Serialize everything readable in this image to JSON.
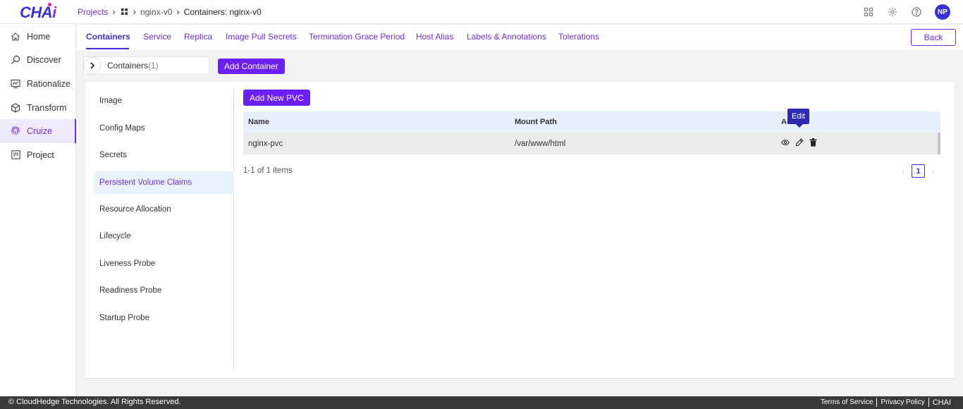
{
  "app": {
    "logo_text": "CHA",
    "logo_accent": "i"
  },
  "breadcrumb": {
    "projects": "Projects",
    "workspace": "nginx-v0",
    "current": "Containers: nginx-v0"
  },
  "user": {
    "initials": "NP"
  },
  "sidebar": {
    "items": [
      {
        "label": "Home",
        "icon": "home-icon"
      },
      {
        "label": "Discover",
        "icon": "discover-icon"
      },
      {
        "label": "Rationalize",
        "icon": "rationalize-icon"
      },
      {
        "label": "Transform",
        "icon": "cube-icon"
      },
      {
        "label": "Cruize",
        "icon": "fingerprint-icon"
      },
      {
        "label": "Project",
        "icon": "board-icon"
      }
    ]
  },
  "tabs": {
    "items": [
      "Containers",
      "Service",
      "Replica",
      "Image Pull Secrets",
      "Termination Grace Period",
      "Host Alias",
      "Labels & Annotations",
      "Tolerations"
    ],
    "back": "Back"
  },
  "containers": {
    "label": "Containers",
    "count": "(1)",
    "add_button": "Add Container"
  },
  "leftmenu": {
    "items": [
      "Image",
      "Config Maps",
      "Secrets",
      "Persistent Volume Claims",
      "Resource Allocation",
      "Lifecycle",
      "Liveness Probe",
      "Readiness Probe",
      "Startup Probe"
    ]
  },
  "pvc": {
    "add_button": "Add New PVC",
    "columns": {
      "name": "Name",
      "mount_path": "Mount Path",
      "actions": "Ac"
    },
    "rows": [
      {
        "name": "nginx-pvc",
        "mount_path": "/var/www/html"
      }
    ],
    "tooltip": "Edit",
    "summary": "1-1 of 1 items",
    "page": "1"
  },
  "footer": {
    "copyright": "© CloudHedge Technologies. All Rights Reserved.",
    "terms": "Terms of Service",
    "privacy": "Privacy Policy",
    "brand": "CHAI"
  },
  "colors": {
    "accent": "#6d2fd6",
    "primary_button": "#6d1ef5",
    "brand": "#3b2fd6"
  }
}
